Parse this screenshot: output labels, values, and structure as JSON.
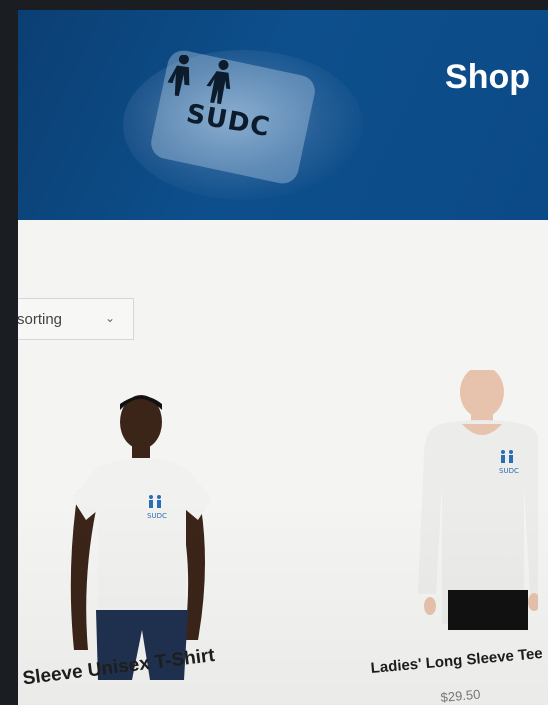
{
  "header": {
    "title": "Shop",
    "logo_text": "SUDC",
    "background_color": "#0d4f8c"
  },
  "sort": {
    "label": "sorting",
    "icon": "chevron-down-icon"
  },
  "products": [
    {
      "name": "t Sleeve Unisex T-Shirt",
      "price": "",
      "image_icon": "man-in-white-tshirt",
      "logo_text": "SUDC"
    },
    {
      "name": "Ladies' Long Sleeve Tee",
      "price": "$29.50",
      "image_icon": "woman-in-long-sleeve-tee",
      "logo_text": "SUDC"
    }
  ]
}
